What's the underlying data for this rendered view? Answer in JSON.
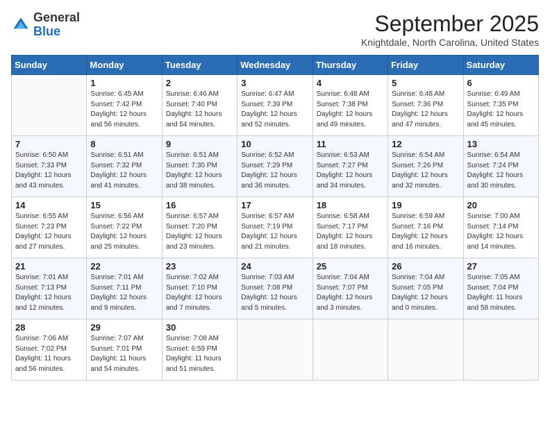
{
  "logo": {
    "general": "General",
    "blue": "Blue"
  },
  "header": {
    "month": "September 2025",
    "location": "Knightdale, North Carolina, United States"
  },
  "columns": [
    "Sunday",
    "Monday",
    "Tuesday",
    "Wednesday",
    "Thursday",
    "Friday",
    "Saturday"
  ],
  "weeks": [
    [
      {
        "day": "",
        "info": ""
      },
      {
        "day": "1",
        "info": "Sunrise: 6:45 AM\nSunset: 7:42 PM\nDaylight: 12 hours\nand 56 minutes."
      },
      {
        "day": "2",
        "info": "Sunrise: 6:46 AM\nSunset: 7:40 PM\nDaylight: 12 hours\nand 54 minutes."
      },
      {
        "day": "3",
        "info": "Sunrise: 6:47 AM\nSunset: 7:39 PM\nDaylight: 12 hours\nand 52 minutes."
      },
      {
        "day": "4",
        "info": "Sunrise: 6:48 AM\nSunset: 7:38 PM\nDaylight: 12 hours\nand 49 minutes."
      },
      {
        "day": "5",
        "info": "Sunrise: 6:48 AM\nSunset: 7:36 PM\nDaylight: 12 hours\nand 47 minutes."
      },
      {
        "day": "6",
        "info": "Sunrise: 6:49 AM\nSunset: 7:35 PM\nDaylight: 12 hours\nand 45 minutes."
      }
    ],
    [
      {
        "day": "7",
        "info": "Sunrise: 6:50 AM\nSunset: 7:33 PM\nDaylight: 12 hours\nand 43 minutes."
      },
      {
        "day": "8",
        "info": "Sunrise: 6:51 AM\nSunset: 7:32 PM\nDaylight: 12 hours\nand 41 minutes."
      },
      {
        "day": "9",
        "info": "Sunrise: 6:51 AM\nSunset: 7:30 PM\nDaylight: 12 hours\nand 38 minutes."
      },
      {
        "day": "10",
        "info": "Sunrise: 6:52 AM\nSunset: 7:29 PM\nDaylight: 12 hours\nand 36 minutes."
      },
      {
        "day": "11",
        "info": "Sunrise: 6:53 AM\nSunset: 7:27 PM\nDaylight: 12 hours\nand 34 minutes."
      },
      {
        "day": "12",
        "info": "Sunrise: 6:54 AM\nSunset: 7:26 PM\nDaylight: 12 hours\nand 32 minutes."
      },
      {
        "day": "13",
        "info": "Sunrise: 6:54 AM\nSunset: 7:24 PM\nDaylight: 12 hours\nand 30 minutes."
      }
    ],
    [
      {
        "day": "14",
        "info": "Sunrise: 6:55 AM\nSunset: 7:23 PM\nDaylight: 12 hours\nand 27 minutes."
      },
      {
        "day": "15",
        "info": "Sunrise: 6:56 AM\nSunset: 7:22 PM\nDaylight: 12 hours\nand 25 minutes."
      },
      {
        "day": "16",
        "info": "Sunrise: 6:57 AM\nSunset: 7:20 PM\nDaylight: 12 hours\nand 23 minutes."
      },
      {
        "day": "17",
        "info": "Sunrise: 6:57 AM\nSunset: 7:19 PM\nDaylight: 12 hours\nand 21 minutes."
      },
      {
        "day": "18",
        "info": "Sunrise: 6:58 AM\nSunset: 7:17 PM\nDaylight: 12 hours\nand 18 minutes."
      },
      {
        "day": "19",
        "info": "Sunrise: 6:59 AM\nSunset: 7:16 PM\nDaylight: 12 hours\nand 16 minutes."
      },
      {
        "day": "20",
        "info": "Sunrise: 7:00 AM\nSunset: 7:14 PM\nDaylight: 12 hours\nand 14 minutes."
      }
    ],
    [
      {
        "day": "21",
        "info": "Sunrise: 7:01 AM\nSunset: 7:13 PM\nDaylight: 12 hours\nand 12 minutes."
      },
      {
        "day": "22",
        "info": "Sunrise: 7:01 AM\nSunset: 7:11 PM\nDaylight: 12 hours\nand 9 minutes."
      },
      {
        "day": "23",
        "info": "Sunrise: 7:02 AM\nSunset: 7:10 PM\nDaylight: 12 hours\nand 7 minutes."
      },
      {
        "day": "24",
        "info": "Sunrise: 7:03 AM\nSunset: 7:08 PM\nDaylight: 12 hours\nand 5 minutes."
      },
      {
        "day": "25",
        "info": "Sunrise: 7:04 AM\nSunset: 7:07 PM\nDaylight: 12 hours\nand 3 minutes."
      },
      {
        "day": "26",
        "info": "Sunrise: 7:04 AM\nSunset: 7:05 PM\nDaylight: 12 hours\nand 0 minutes."
      },
      {
        "day": "27",
        "info": "Sunrise: 7:05 AM\nSunset: 7:04 PM\nDaylight: 11 hours\nand 58 minutes."
      }
    ],
    [
      {
        "day": "28",
        "info": "Sunrise: 7:06 AM\nSunset: 7:02 PM\nDaylight: 11 hours\nand 56 minutes."
      },
      {
        "day": "29",
        "info": "Sunrise: 7:07 AM\nSunset: 7:01 PM\nDaylight: 11 hours\nand 54 minutes."
      },
      {
        "day": "30",
        "info": "Sunrise: 7:08 AM\nSunset: 6:59 PM\nDaylight: 11 hours\nand 51 minutes."
      },
      {
        "day": "",
        "info": ""
      },
      {
        "day": "",
        "info": ""
      },
      {
        "day": "",
        "info": ""
      },
      {
        "day": "",
        "info": ""
      }
    ]
  ]
}
